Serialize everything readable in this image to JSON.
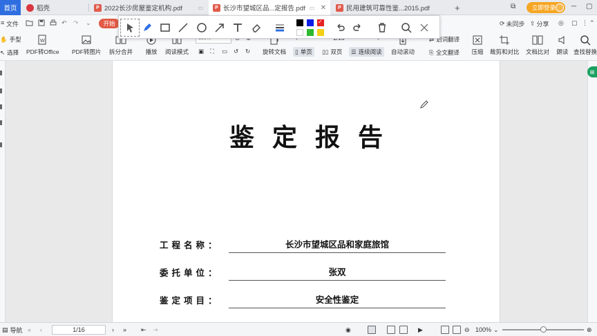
{
  "tabs": {
    "home": "首页",
    "items": [
      {
        "label": "稻壳",
        "color": "#d9363e",
        "active": false
      },
      {
        "label": "2022长沙房屋鉴定机构.pdf",
        "color": "#e05a4b",
        "active": false
      },
      {
        "label": "长沙市望城区品...定报告.pdf",
        "color": "#e05a4b",
        "active": true
      },
      {
        "label": "民用建筑可靠性鉴...2015.pdf",
        "color": "#e05a4b",
        "active": false
      }
    ],
    "add": "+",
    "login": "立即登录"
  },
  "menu": {
    "file": "文件",
    "start": "开始",
    "sync": "未同步",
    "share": "分享"
  },
  "ribbon": {
    "hand": "手型",
    "select": "选择",
    "pdf_to_office": "PDF转Office",
    "pdf_to_image": "PDF转图片",
    "split_merge": "拆分合并",
    "play": "播放",
    "read_mode": "阅读模式",
    "zoom": "100%",
    "rotate_doc": "旋转文档",
    "single_page": "单页",
    "double_page": "双页",
    "continuous": "连续阅读",
    "page_indicator": "1/16",
    "auto_scroll": "自动滚动",
    "word_translate": "划词翻译",
    "full_translate": "全文翻译",
    "compress": "压缩",
    "crop_compare": "裁剪和对比",
    "doc_compare": "文档比对",
    "read_aloud": "朗读",
    "find_replace": "查找替换"
  },
  "annot_colors": [
    "#000000",
    "#0a1ee6",
    "#e52222",
    "#ffffff",
    "#2eb82e",
    "#f2d016"
  ],
  "document": {
    "title": "鉴定报告",
    "fields": [
      {
        "label": "工程名称：",
        "value": "长沙市望城区品和家庭旅馆"
      },
      {
        "label": "委托单位：",
        "value": "张双"
      },
      {
        "label": "鉴定项目：",
        "value": "安全性鉴定"
      }
    ]
  },
  "status": {
    "nav": "导航",
    "page": "1/16",
    "zoom": "100%",
    "zoom_level": 0.5
  }
}
